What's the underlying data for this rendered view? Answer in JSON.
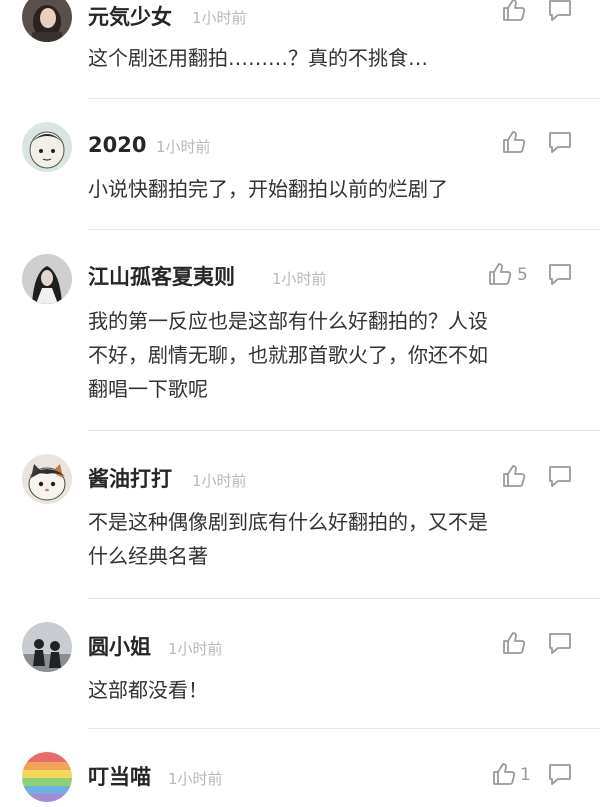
{
  "comments": [
    {
      "name": "元気少女",
      "time": "1小时前",
      "lines": [
        "这个剧还用翻拍………？真的不挑食…"
      ],
      "likes": "",
      "avatar": "avatar-girl-dark-hair"
    },
    {
      "name": "2020",
      "time": "1小时前",
      "lines": [
        "小说快翻拍完了，开始翻拍以前的烂剧了"
      ],
      "likes": "",
      "avatar": "avatar-cartoon-face"
    },
    {
      "name": "江山孤客夏夷则",
      "time": "1小时前",
      "lines": [
        "我的第一反应也是这部有什么好翻拍的？人设",
        "不好，剧情无聊，也就那首歌火了，你还不如",
        "翻唱一下歌呢"
      ],
      "likes": "5",
      "avatar": "avatar-long-hair-figure"
    },
    {
      "name": "酱油打打",
      "time": "1小时前",
      "lines": [
        "不是这种偶像剧到底有什么好翻拍的，又不是",
        "什么经典名著"
      ],
      "likes": "",
      "avatar": "avatar-cat"
    },
    {
      "name": "圆小姐",
      "time": "1小时前",
      "lines": [
        "这部都没看！"
      ],
      "likes": "",
      "avatar": "avatar-silhouettes"
    },
    {
      "name": "叮当喵",
      "time": "1小时前",
      "lines": [],
      "likes": "1",
      "avatar": "avatar-rainbow"
    }
  ],
  "icons": {
    "like": "thumbs-up-icon",
    "reply": "comment-bubble-icon"
  },
  "colors": {
    "name": "#262626",
    "time": "#b8b8b8",
    "icon": "#9a9a9a",
    "divider": "#e6e6e6"
  }
}
